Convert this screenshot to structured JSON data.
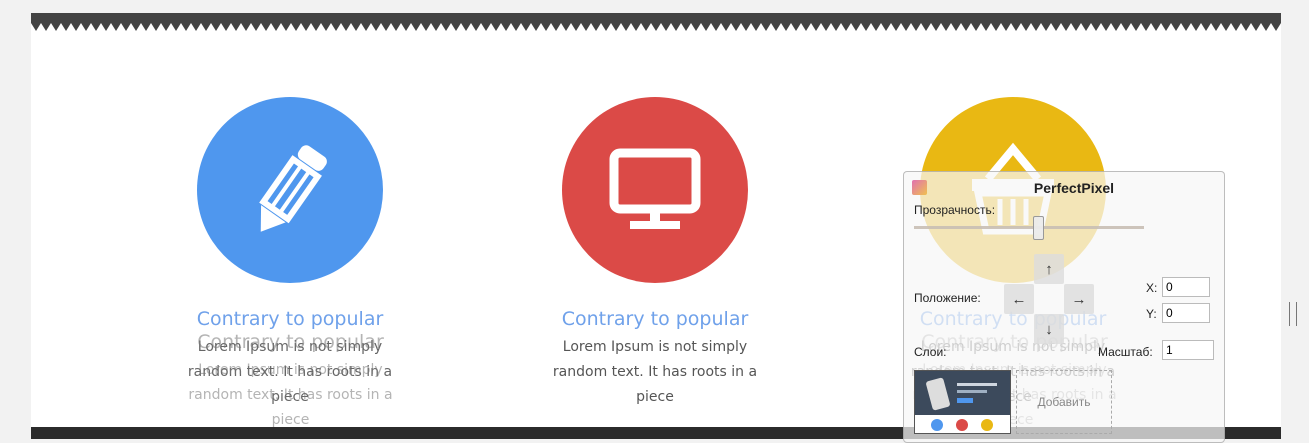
{
  "features": [
    {
      "title": "Contrary to popular",
      "text": "Lorem Ipsum is not simply random text. It has roots in a piece",
      "color": "#4f97ee",
      "icon": "pencil-icon"
    },
    {
      "title": "Contrary to popular",
      "text": "Lorem Ipsum is not simply random text. It has roots in a piece",
      "color": "#db4a47",
      "icon": "monitor-icon"
    },
    {
      "title": "Contrary to popular",
      "text": "Lorem Ipsum is not simply random text. It has roots in a piece",
      "color": "#e9b813",
      "icon": "basket-icon"
    }
  ],
  "colors": {
    "title": "#6fa1ea",
    "text": "#555555",
    "footer": "#2b2b2b"
  },
  "perfectpixel": {
    "title": "PerfectPixel",
    "opacity_label": "Прозрачность:",
    "position_label": "Положение:",
    "layers_label": "Слои:",
    "scale_label": "Масштаб:",
    "x_label": "X:",
    "y_label": "Y:",
    "x_value": "0",
    "y_value": "0",
    "scale_value": "1",
    "add_label": "Добавить",
    "arrows": {
      "up": "↑",
      "left": "←",
      "right": "→",
      "down": "↓"
    }
  }
}
